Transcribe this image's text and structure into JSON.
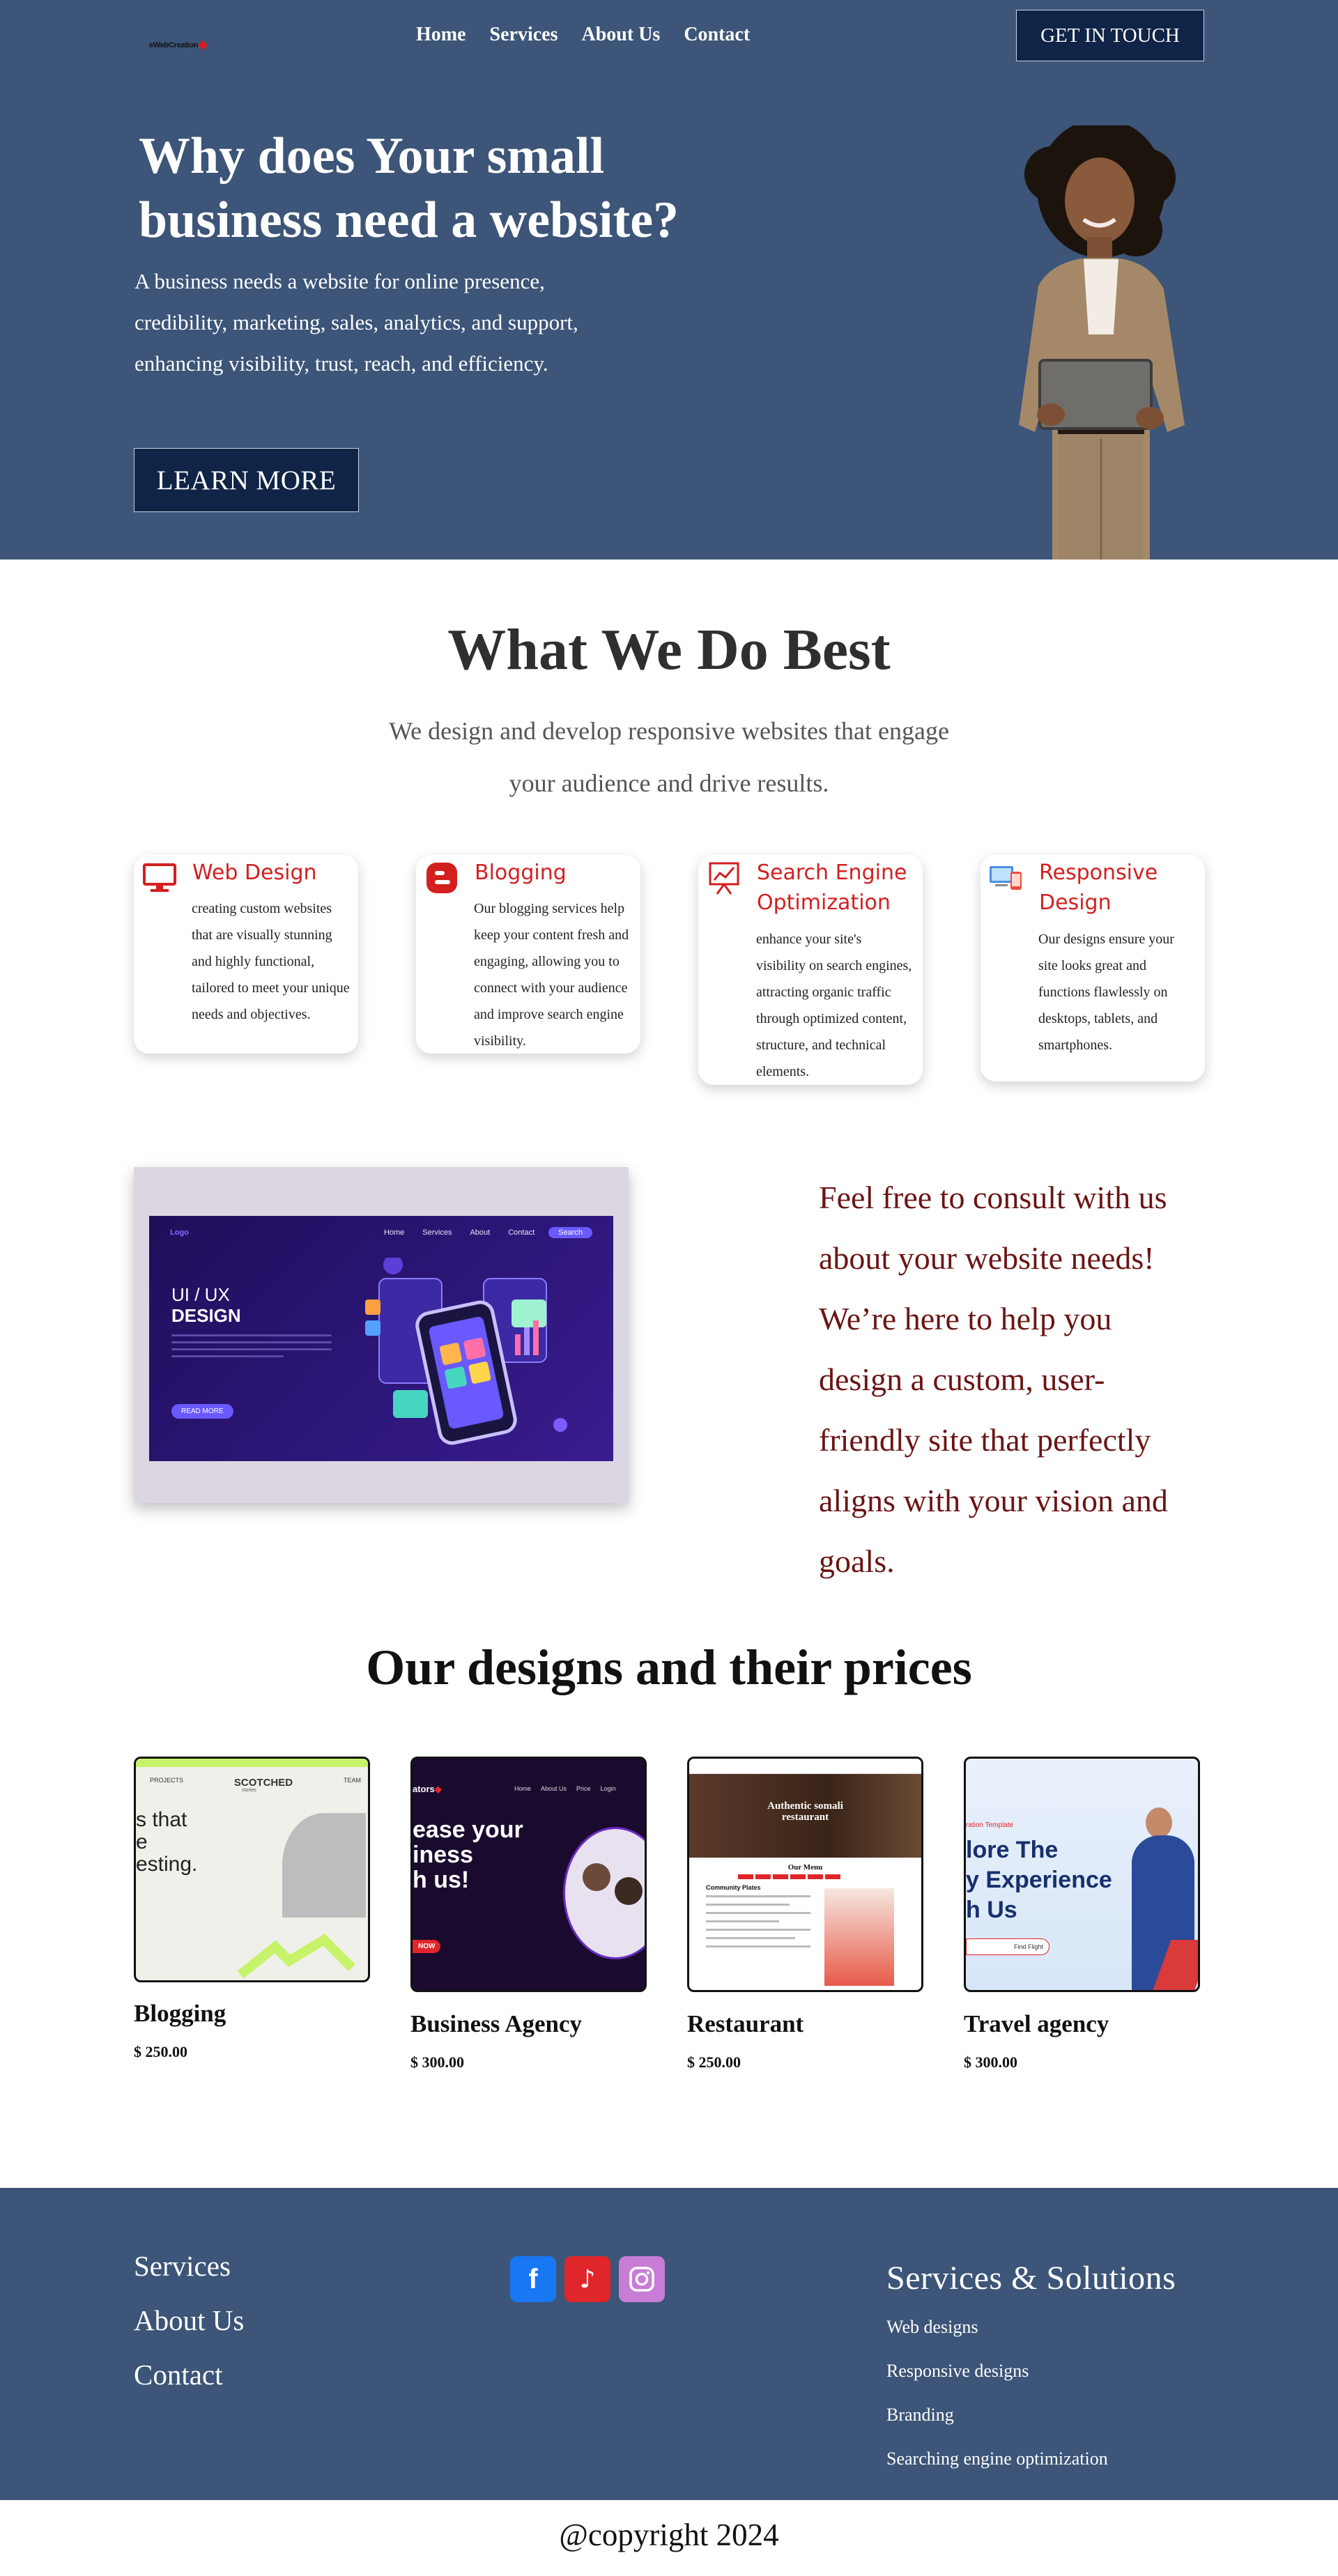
{
  "header": {
    "logo_text": "eWebCreation",
    "nav": [
      "Home",
      "Services",
      "About Us",
      "Contact"
    ],
    "cta": "GET IN TOUCH"
  },
  "hero": {
    "title_line1": "Why does Your small",
    "title_line2": "business need a website?",
    "text_line1": "A business needs a website for online presence,",
    "text_line2": "credibility, marketing, sales, analytics, and support,",
    "text_line3": "enhancing visibility, trust, reach, and efficiency.",
    "button": "LEARN MORE"
  },
  "what_we_do": {
    "title": "What We Do Best",
    "subtitle_line1": "We design and develop responsive websites that engage",
    "subtitle_line2": "your audience and drive results.",
    "cards": [
      {
        "icon": "monitor-icon",
        "title": "Web Design",
        "lines": [
          "creating custom websites",
          "that are visually stunning",
          "and highly functional,",
          "tailored to meet your unique",
          "needs and objectives."
        ]
      },
      {
        "icon": "blogger-icon",
        "title": "Blogging",
        "lines": [
          "Our blogging services help",
          "keep your content fresh and",
          "engaging, allowing you to",
          "connect with your audience",
          "and improve search engine",
          "visibility."
        ]
      },
      {
        "icon": "seo-chart-icon",
        "title_line1": "Search Engine",
        "title_line2": "Optimization",
        "lines": [
          "enhance your site's",
          "visibility on search engines,",
          "attracting organic traffic",
          "through optimized content,",
          "structure, and technical",
          "elements."
        ]
      },
      {
        "icon": "devices-icon",
        "title_line1": "Responsive",
        "title_line2": "Design",
        "lines": [
          "Our designs ensure your",
          "site looks great and",
          "functions flawlessly on",
          "desktops, tablets, and",
          "smartphones."
        ]
      }
    ],
    "colors": {
      "card_title": "#d41f1f"
    }
  },
  "consult": {
    "mockup": {
      "logo": "Logo",
      "nav": [
        "Home",
        "Services",
        "About",
        "Contact"
      ],
      "search": "Search",
      "heading_line1": "UI / UX",
      "heading_line2": "DESIGN",
      "button": "READ MORE"
    },
    "lines": [
      "Feel free to consult with us",
      "about your website needs!",
      "We’re here to help you",
      "design a custom, user-",
      "friendly site that perfectly",
      "aligns with your vision and",
      "goals."
    ],
    "color": "#6b1414"
  },
  "prices": {
    "title": "Our designs and their prices",
    "items": [
      {
        "name": "Blogging",
        "price": "$ 250.00",
        "thumb": {
          "nav": [
            "PROJECTS",
            "SCOTCHED",
            "TEAM"
          ],
          "brand_sub": "stories",
          "headline": [
            "s that",
            "e",
            "esting."
          ]
        }
      },
      {
        "name": "Business Agency",
        "price": "$ 300.00",
        "thumb": {
          "brand": "ators",
          "nav": [
            "Home",
            "About Us",
            "Price",
            "Login"
          ],
          "headline": [
            "ease your",
            "iness",
            "h us!"
          ],
          "button": "NOW"
        }
      },
      {
        "name": "Restaurant",
        "price": "$ 250.00",
        "thumb": {
          "hero_line1": "Authentic somali",
          "hero_line2": "restaurant",
          "menu_title": "Our Menu",
          "menu_section": "Community Plates"
        }
      },
      {
        "name": "Travel agency",
        "price": "$ 300.00",
        "thumb": {
          "kicker": "ration Template",
          "headline": [
            "lore The",
            "y Experience",
            "h Us"
          ],
          "button": "Find Flight"
        }
      }
    ]
  },
  "footer": {
    "links": [
      "Services",
      "About Us",
      "Contact"
    ],
    "social": [
      {
        "icon": "facebook-icon",
        "glyph": "f",
        "color": "#1877f2"
      },
      {
        "icon": "tiktok-icon",
        "glyph": "♪",
        "color": "#e0262a"
      },
      {
        "icon": "instagram-icon",
        "glyph": "◎",
        "color": "#c77dd6"
      }
    ],
    "solutions_title": "Services & Solutions",
    "solutions": [
      "Web designs",
      "Responsive designs",
      "Branding",
      "Searching engine optimization"
    ],
    "copyright": "@copyright 2024"
  }
}
